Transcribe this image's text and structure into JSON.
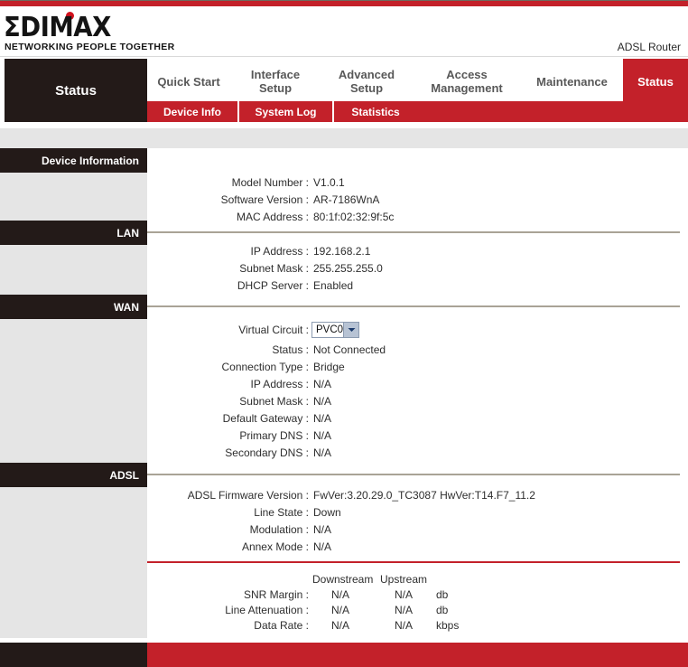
{
  "brand": {
    "logo_text": "ΣDIMAX",
    "tagline": "NETWORKING PEOPLE TOGETHER",
    "product_name": "ADSL Router",
    "accent_red": "#c3212a",
    "dark": "#231a18",
    "sidebar_gray": "#e5e5e5"
  },
  "nav": {
    "current_section": "Status",
    "tabs": [
      {
        "label": "Quick Start",
        "active": false
      },
      {
        "label": "Interface Setup",
        "active": false
      },
      {
        "label": "Advanced Setup",
        "active": false
      },
      {
        "label": "Access Management",
        "active": false
      },
      {
        "label": "Maintenance",
        "active": false
      },
      {
        "label": "Status",
        "active": true
      }
    ],
    "subtabs": [
      {
        "label": "Device Info",
        "active": true
      },
      {
        "label": "System Log",
        "active": false
      },
      {
        "label": "Statistics",
        "active": false
      }
    ]
  },
  "sections": {
    "device_information": {
      "title": "Device Information",
      "rows": [
        {
          "label": "Model Number :",
          "value": "V1.0.1"
        },
        {
          "label": "Software Version :",
          "value": "AR-7186WnA"
        },
        {
          "label": "MAC Address :",
          "value": "80:1f:02:32:9f:5c"
        }
      ]
    },
    "lan": {
      "title": "LAN",
      "rows": [
        {
          "label": "IP Address :",
          "value": "192.168.2.1"
        },
        {
          "label": "Subnet Mask :",
          "value": "255.255.255.0"
        },
        {
          "label": "DHCP Server :",
          "value": "Enabled"
        }
      ]
    },
    "wan": {
      "title": "WAN",
      "virtual_circuit_label": "Virtual Circuit :",
      "virtual_circuit_value": "PVC0",
      "rows": [
        {
          "label": "Status :",
          "value": "Not Connected"
        },
        {
          "label": "Connection Type :",
          "value": "Bridge"
        },
        {
          "label": "IP Address :",
          "value": "N/A"
        },
        {
          "label": "Subnet Mask :",
          "value": "N/A"
        },
        {
          "label": "Default Gateway :",
          "value": "N/A"
        },
        {
          "label": "Primary DNS :",
          "value": "N/A"
        },
        {
          "label": "Secondary DNS :",
          "value": "N/A"
        }
      ]
    },
    "adsl": {
      "title": "ADSL",
      "rows": [
        {
          "label": "ADSL Firmware Version :",
          "value": "FwVer:3.20.29.0_TC3087 HwVer:T14.F7_11.2"
        },
        {
          "label": "Line State :",
          "value": "Down"
        },
        {
          "label": "Modulation :",
          "value": "N/A"
        },
        {
          "label": "Annex Mode :",
          "value": "N/A"
        }
      ]
    },
    "stats": {
      "col_downstream": "Downstream",
      "col_upstream": "Upstream",
      "rows": [
        {
          "label": "SNR Margin :",
          "downstream": "N/A",
          "upstream": "N/A",
          "unit": "db"
        },
        {
          "label": "Line Attenuation :",
          "downstream": "N/A",
          "upstream": "N/A",
          "unit": "db"
        },
        {
          "label": "Data Rate :",
          "downstream": "N/A",
          "upstream": "N/A",
          "unit": "kbps"
        }
      ]
    }
  }
}
